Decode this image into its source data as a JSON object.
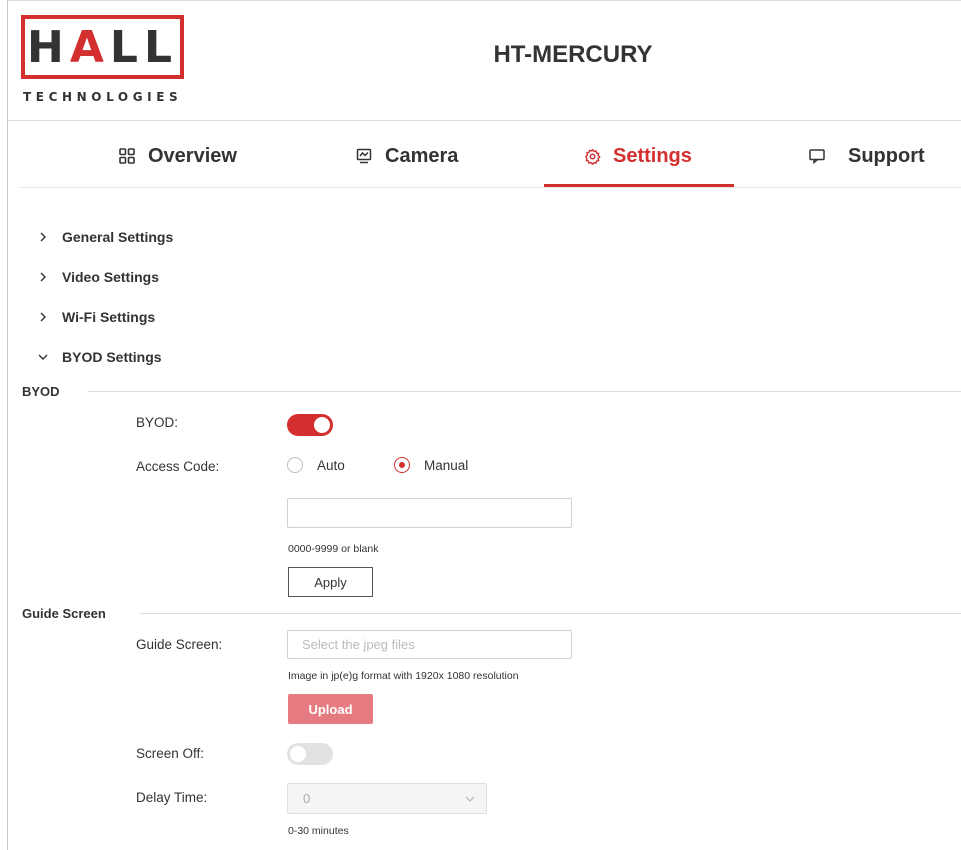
{
  "brand": {
    "logo_word": "HALL",
    "logo_sub": "TECHNOLOGIES",
    "accent_color": "#d32f2f"
  },
  "header": {
    "title": "HT-MERCURY"
  },
  "tabs": [
    {
      "label": "Overview",
      "icon": "grid-icon"
    },
    {
      "label": "Camera",
      "icon": "camera-monitor-icon"
    },
    {
      "label": "Settings",
      "icon": "gear-icon",
      "active": true
    },
    {
      "label": "Support",
      "icon": "chat-icon"
    }
  ],
  "accordion": [
    {
      "label": "General Settings",
      "expanded": false
    },
    {
      "label": "Video Settings",
      "expanded": false
    },
    {
      "label": "Wi-Fi Settings",
      "expanded": false
    },
    {
      "label": "BYOD Settings",
      "expanded": true
    }
  ],
  "byod": {
    "section_title": "BYOD",
    "byod_label": "BYOD:",
    "byod_enabled": true,
    "access_code_label": "Access Code:",
    "access_code_options": [
      "Auto",
      "Manual"
    ],
    "access_code_selected": "Manual",
    "access_code_value": "",
    "access_code_hint": "0000-9999 or blank",
    "apply_label": "Apply"
  },
  "guide": {
    "section_title": "Guide Screen",
    "guide_label": "Guide Screen:",
    "file_placeholder": "Select the jpeg files",
    "file_hint": "Image in jp(e)g format with 1920x 1080 resolution",
    "upload_label": "Upload",
    "screen_off_label": "Screen Off:",
    "screen_off_enabled": false,
    "delay_label": "Delay Time:",
    "delay_value": "0",
    "delay_hint": "0-30 minutes"
  }
}
